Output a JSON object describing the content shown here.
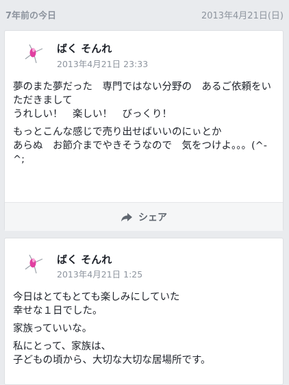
{
  "header": {
    "memory_label": "7年前の今日",
    "memory_date": "2013年4月21日(日)"
  },
  "posts": [
    {
      "author": "ばく そんれ",
      "timestamp": "2013年4月21日 23:33",
      "paragraphs": [
        "夢のまた夢だった　専門ではない分野の　あるご依頼をいただきまして",
        "うれしい！　楽しい！　びっくり！",
        "もっとこんな感じで売り出せばいいのにぃとか",
        "あらぬ　お節介までやきそうなので　気をつけよ。。。(^-^;"
      ],
      "share_label": "シェア"
    },
    {
      "author": "ばく そんれ",
      "timestamp": "2013年4月21日 1:25",
      "paragraphs": [
        "今日はとてもとても楽しみにしていた",
        "幸せな１日でした。",
        "家族っていいな。",
        "私にとって、家族は、",
        "子どもの頃から、大切な大切な居場所です。"
      ]
    }
  ],
  "colors": {
    "background": "#e9ebee",
    "card": "#ffffff",
    "muted_text": "#8d949e",
    "avatar_accent": "#e040a0"
  },
  "icons": {
    "avatar": "pink-star-avatar",
    "share": "share-arrow-icon"
  }
}
